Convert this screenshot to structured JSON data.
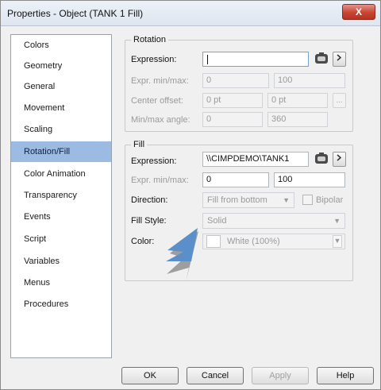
{
  "window": {
    "title": "Properties - Object (TANK 1 Fill)",
    "close_label": "X"
  },
  "sidebar": {
    "items": [
      {
        "label": "Colors"
      },
      {
        "label": "Geometry"
      },
      {
        "label": "General"
      },
      {
        "label": "Movement"
      },
      {
        "label": "Scaling"
      },
      {
        "label": "Rotation/Fill",
        "selected": true
      },
      {
        "label": "Color Animation"
      },
      {
        "label": "Transparency"
      },
      {
        "label": "Events"
      },
      {
        "label": "Script"
      },
      {
        "label": "Variables"
      },
      {
        "label": "Menus"
      },
      {
        "label": "Procedures"
      }
    ]
  },
  "rotation": {
    "title": "Rotation",
    "expression_label": "Expression:",
    "expression_value": "",
    "expr_minmax_label": "Expr. min/max:",
    "expr_min": "0",
    "expr_max": "100",
    "center_offset_label": "Center offset:",
    "center_x": "0 pt",
    "center_y": "0 pt",
    "minmax_angle_label": "Min/max angle:",
    "angle_min": "0",
    "angle_max": "360",
    "more_label": "..."
  },
  "fill": {
    "title": "Fill",
    "expression_label": "Expression:",
    "expression_value": "\\\\CIMPDEMO\\TANK1",
    "expr_minmax_label": "Expr. min/max:",
    "expr_min": "0",
    "expr_max": "100",
    "direction_label": "Direction:",
    "direction_value": "Fill from bottom",
    "bipolar_label": "Bipolar",
    "fill_style_label": "Fill Style:",
    "fill_style_value": "Solid",
    "color_label": "Color:",
    "color_value": "White (100%)"
  },
  "buttons": {
    "ok": "OK",
    "cancel": "Cancel",
    "apply": "Apply",
    "help": "Help"
  },
  "icons": {
    "browse": "tag-browser-icon",
    "goto": "chevron-right-icon",
    "dropdown": "chevron-down-icon"
  },
  "colors": {
    "selected": "#9bbbe2",
    "close": "#c84433",
    "pointer": "#5b8fc9"
  }
}
